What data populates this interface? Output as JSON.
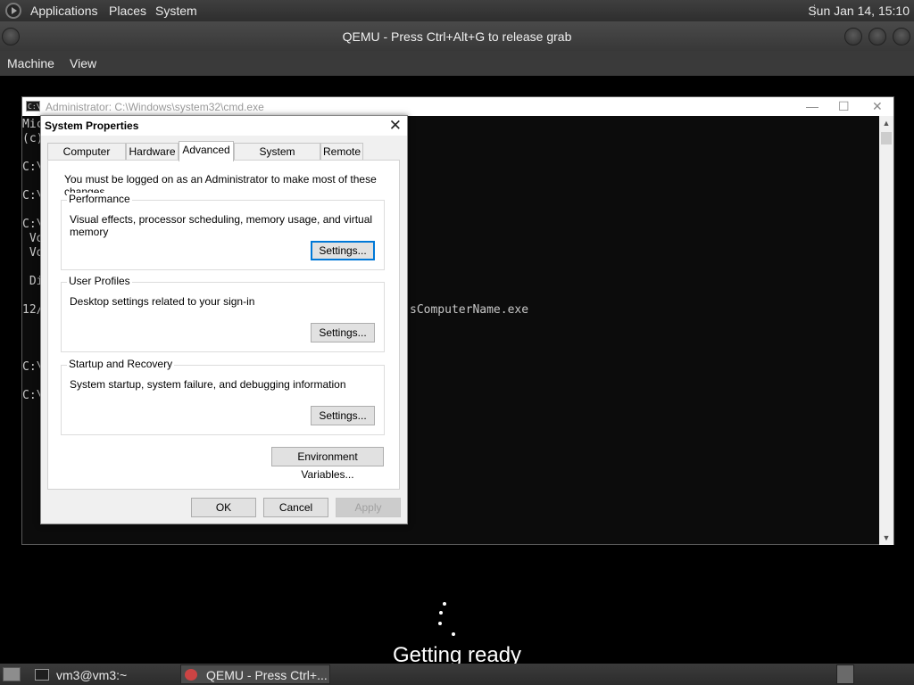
{
  "top_panel": {
    "menus": [
      "Applications",
      "Places",
      "System"
    ],
    "clock": "Sun Jan 14, 15:10"
  },
  "qemu": {
    "title": "QEMU - Press Ctrl+Alt+G to release grab",
    "menu": [
      "Machine",
      "View"
    ]
  },
  "cmd": {
    "title": "Administrator: C:\\Windows\\system32\\cmd.exe",
    "icon_text": "C:\\",
    "controls": {
      "minimize": "—",
      "maximize": "☐",
      "close": "✕"
    },
    "lines": [
      "Mic",
      "(c)",
      "C:\\",
      "C:\\",
      "C:\\",
      " Vo",
      " Vo",
      " Di",
      "12/",
      "C:\\",
      "C:\\"
    ],
    "right_text": "sComputerName.exe"
  },
  "system_properties": {
    "title": "System Properties",
    "close": "✕",
    "tabs": [
      "Computer Name",
      "Hardware",
      "Advanced",
      "System Protection",
      "Remote"
    ],
    "active_tab": "Advanced",
    "notice": "You must be logged on as an Administrator to make most of these changes.",
    "groups": [
      {
        "legend": "Performance",
        "desc": "Visual effects, processor scheduling, memory usage, and virtual memory",
        "button": "Settings..."
      },
      {
        "legend": "User Profiles",
        "desc": "Desktop settings related to your sign-in",
        "button": "Settings..."
      },
      {
        "legend": "Startup and Recovery",
        "desc": "System startup, system failure, and debugging information",
        "button": "Settings..."
      }
    ],
    "env_button": "Environment Variables...",
    "buttons": {
      "ok": "OK",
      "cancel": "Cancel",
      "apply": "Apply"
    }
  },
  "boot": {
    "status": "Getting ready"
  },
  "taskbar": {
    "tasks": [
      {
        "label": "vm3@vm3:~",
        "active": false
      },
      {
        "label": "QEMU - Press Ctrl+...",
        "active": true
      }
    ]
  }
}
